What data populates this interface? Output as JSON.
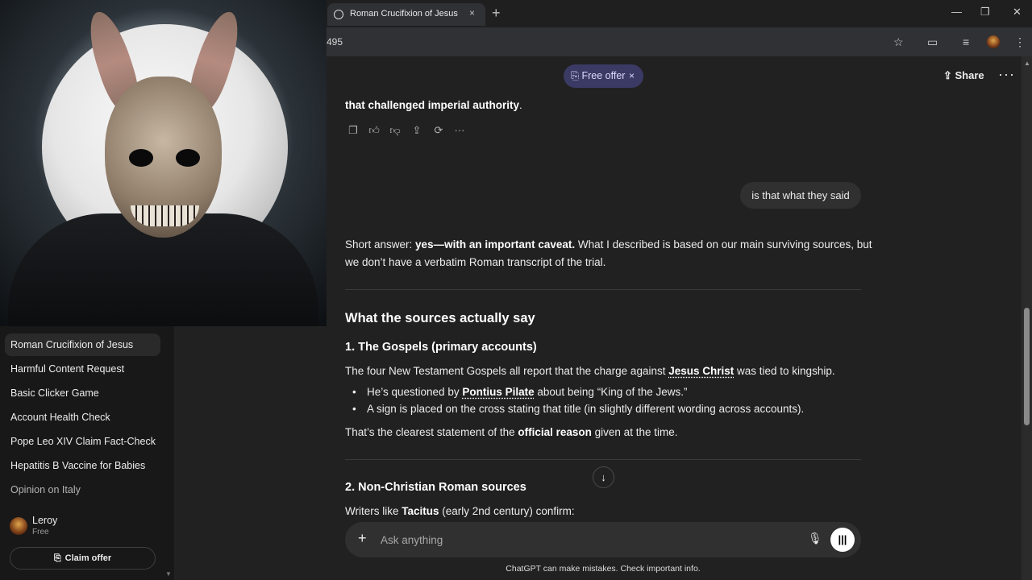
{
  "browser": {
    "tab_title": "Roman Crucifixion of Jesus",
    "tab_close": "×",
    "new_tab": "+",
    "url_fragment": "495",
    "window_controls": {
      "minimize": "—",
      "maximize": "❐",
      "close": "✕"
    },
    "toolbar_icons": [
      "star-icon",
      "cast-icon",
      "media-icon",
      "profile-avatar",
      "menu-icon"
    ]
  },
  "sidebar": {
    "items": [
      {
        "label": "Roman Crucifixion of Jesus",
        "active": true
      },
      {
        "label": "Harmful Content Request"
      },
      {
        "label": "Basic Clicker Game"
      },
      {
        "label": "Account Health Check"
      },
      {
        "label": "Pope Leo XIV Claim Fact-Check"
      },
      {
        "label": "Hepatitis B Vaccine for Babies"
      },
      {
        "label": "Opinion on Italy"
      }
    ],
    "user": {
      "name": "Leroy",
      "plan": "Free"
    },
    "claim_offer": "Claim offer"
  },
  "header": {
    "free_offer": "Free offer",
    "free_offer_close": "×",
    "share": "Share",
    "more": "···"
  },
  "conversation": {
    "prev_tail_bold": "that challenged imperial authority",
    "prev_tail_end": ".",
    "user_message": "is that what they said",
    "answer": {
      "intro_prefix": "Short answer: ",
      "intro_bold": "yes—with an important caveat.",
      "intro_rest_line1": " What I described is based on our main surviving sources, but",
      "intro_rest_line2": "we don’t have a verbatim Roman transcript of the trial.",
      "heading": "What the sources actually say",
      "section1_title": "1. The Gospels (primary accounts)",
      "section1_p_pre": "The four New Testament Gospels all report that the charge against ",
      "section1_p_link": "Jesus Christ",
      "section1_p_post": " was tied to kingship.",
      "bullet1_pre": "He’s questioned by ",
      "bullet1_link": "Pontius Pilate",
      "bullet1_post": " about being “King of the Jews.”",
      "bullet2": "A sign is placed on the cross stating that title (in slightly different wording across accounts).",
      "section1_close_pre": "That’s the clearest statement of the ",
      "section1_close_bold": "official reason",
      "section1_close_post": " given at the time.",
      "section2_title": "2. Non-Christian Roman sources",
      "section2_p_pre": "Writers like ",
      "section2_p_bold": "Tacitus",
      "section2_p_post": " (early 2nd century) confirm:"
    }
  },
  "composer": {
    "placeholder": "Ask anything",
    "disclaimer": "ChatGPT can make mistakes. Check important info."
  }
}
